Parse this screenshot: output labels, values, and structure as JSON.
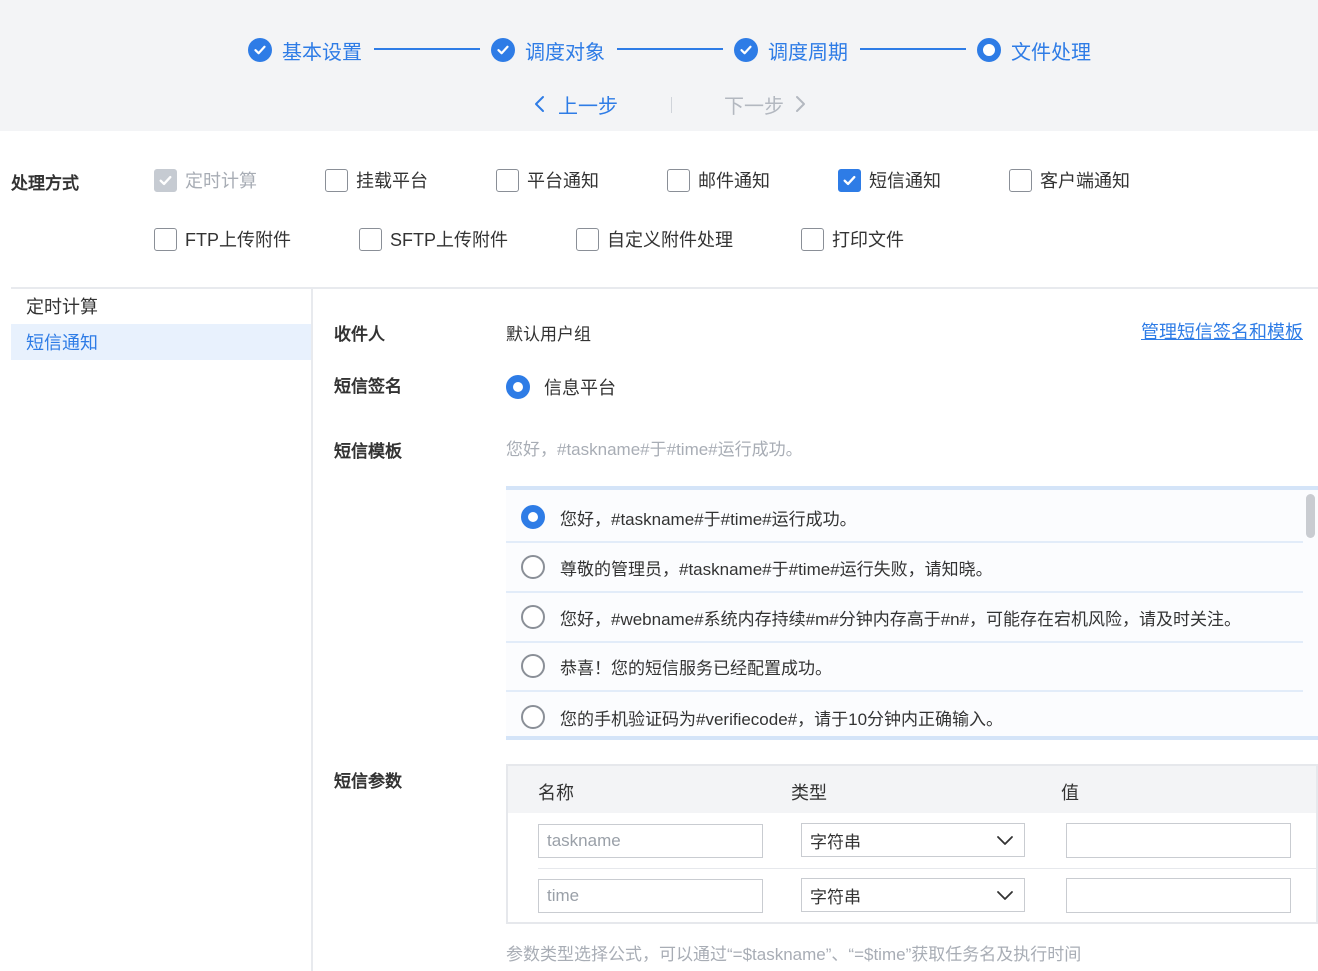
{
  "steps": [
    {
      "label": "基本设置",
      "state": "done"
    },
    {
      "label": "调度对象",
      "state": "done"
    },
    {
      "label": "调度周期",
      "state": "done"
    },
    {
      "label": "文件处理",
      "state": "current"
    }
  ],
  "nav": {
    "prev": "上一步",
    "next": "下一步",
    "prev_icon": "chevron-left-icon",
    "next_icon": "chevron-right-icon"
  },
  "processing": {
    "label": "处理方式",
    "options": [
      {
        "label": "定时计算",
        "checked": true,
        "disabled": true
      },
      {
        "label": "挂载平台",
        "checked": false
      },
      {
        "label": "平台通知",
        "checked": false
      },
      {
        "label": "邮件通知",
        "checked": false
      },
      {
        "label": "短信通知",
        "checked": true
      },
      {
        "label": "客户端通知",
        "checked": false
      },
      {
        "label": "FTP上传附件",
        "checked": false
      },
      {
        "label": "SFTP上传附件",
        "checked": false
      },
      {
        "label": "自定义附件处理",
        "checked": false
      },
      {
        "label": "打印文件",
        "checked": false
      }
    ]
  },
  "side_list": [
    {
      "label": "定时计算",
      "active": false
    },
    {
      "label": "短信通知",
      "active": true
    }
  ],
  "form": {
    "recipient_label": "收件人",
    "recipient_value": "默认用户组",
    "manage_link": "管理短信签名和模板",
    "signature_label": "短信签名",
    "signature_option": "信息平台",
    "template_label": "短信模板",
    "template_preview": "您好，#taskname#于#time#运行成功。",
    "templates": [
      {
        "text": "您好，#taskname#于#time#运行成功。",
        "selected": true
      },
      {
        "text": "尊敬的管理员，#taskname#于#time#运行失败，请知晓。",
        "selected": false
      },
      {
        "text": "您好，#webname#系统内存持续#m#分钟内存高于#n#，可能存在宕机风险，请及时关注。",
        "selected": false
      },
      {
        "text": "恭喜！您的短信服务已经配置成功。",
        "selected": false
      },
      {
        "text": "您的手机验证码为#verifiecode#，请于10分钟内正确输入。",
        "selected": false
      }
    ],
    "params_label": "短信参数",
    "params_headers": {
      "name": "名称",
      "type": "类型",
      "value": "值"
    },
    "params_rows": [
      {
        "name_placeholder": "taskname",
        "type": "字符串",
        "value": ""
      },
      {
        "name_placeholder": "time",
        "type": "字符串",
        "value": ""
      }
    ],
    "hint": "参数类型选择公式，可以通过“=$taskname”、“=$time”获取任务名及执行时间"
  },
  "colors": {
    "accent": "#2e7ce6",
    "header_bg": "#f3f4f6",
    "muted": "#a8adb5"
  }
}
